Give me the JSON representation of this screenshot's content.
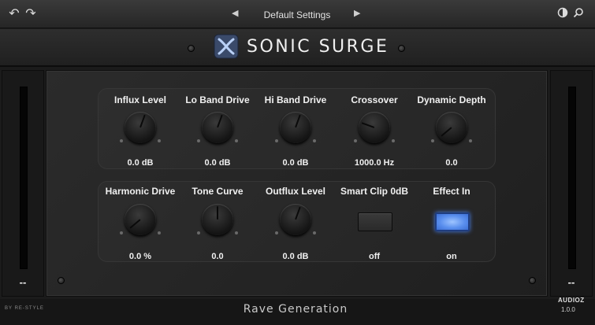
{
  "toolbar": {
    "undo_icon": "undo-icon",
    "redo_icon": "redo-icon",
    "prev_preset_glyph": "◀",
    "next_preset_glyph": "▶",
    "preset_name": "Default Settings",
    "contrast_icon": "half-circle-icon",
    "search_icon": "magnifier-icon"
  },
  "header": {
    "brand_name": "SONIC SURGE",
    "logo_icon": "x-surge-logo"
  },
  "meters": {
    "left_value": "--",
    "right_value": "--"
  },
  "row1": [
    {
      "label": "Influx Level",
      "value": "0.0 dB",
      "knob_rotation_deg": 20
    },
    {
      "label": "Lo Band Drive",
      "value": "0.0 dB",
      "knob_rotation_deg": 20
    },
    {
      "label": "Hi Band Drive",
      "value": "0.0 dB",
      "knob_rotation_deg": 20
    },
    {
      "label": "Crossover",
      "value": "1000.0 Hz",
      "knob_rotation_deg": -70
    },
    {
      "label": "Dynamic Depth",
      "value": "0.0",
      "knob_rotation_deg": -130
    }
  ],
  "row2": [
    {
      "label": "Harmonic Drive",
      "value": "0.0 %",
      "knob_rotation_deg": -130
    },
    {
      "label": "Tone Curve",
      "value": "0.0",
      "knob_rotation_deg": 0
    },
    {
      "label": "Outflux Level",
      "value": "0.0 dB",
      "knob_rotation_deg": 20
    },
    {
      "label": "Smart Clip 0dB",
      "value": "off",
      "state": false
    },
    {
      "label": "Effect In",
      "value": "on",
      "state": true
    }
  ],
  "colors": {
    "accent_on": "#5a8fee",
    "panel": "#262626"
  },
  "footer": {
    "vendor_small": "BY RE-STYLE",
    "brand": "Rave Generation"
  },
  "watermark": {
    "brand": "AUDIOZ",
    "version": "1.0.0"
  }
}
